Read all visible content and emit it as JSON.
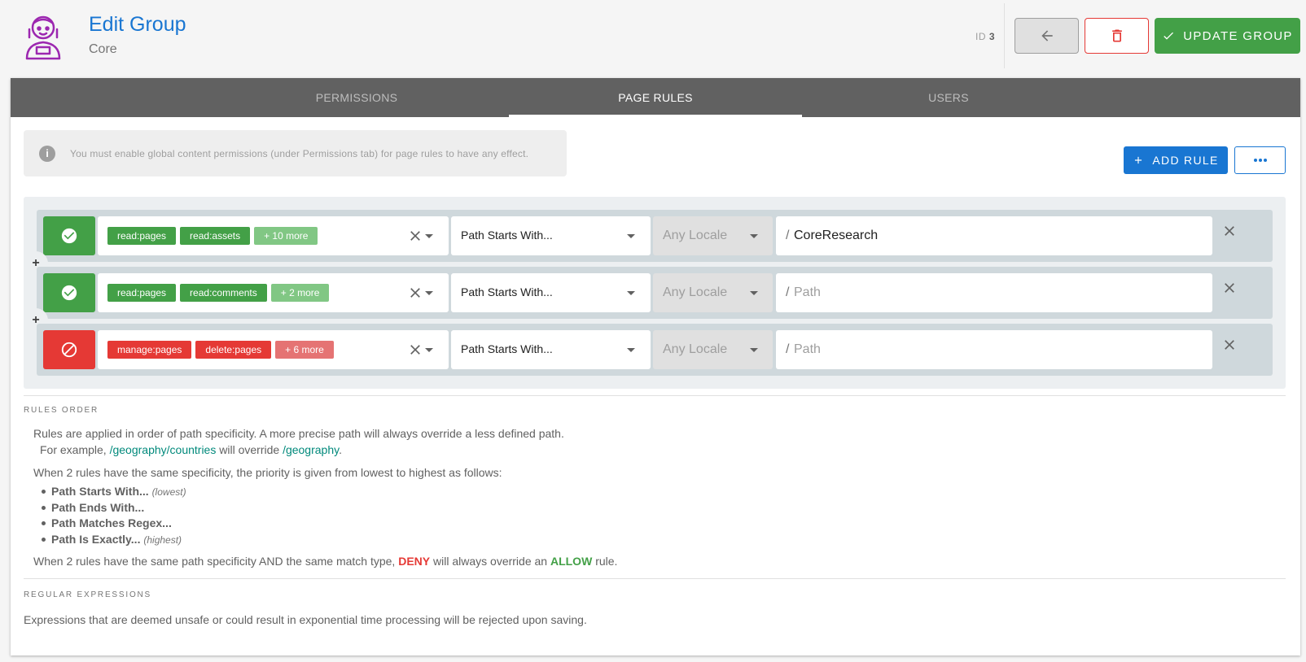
{
  "header": {
    "title": "Edit Group",
    "subtitle": "Core",
    "id_label": "ID",
    "id_value": "3",
    "update_label": "UPDATE GROUP"
  },
  "tabs": [
    {
      "label": "PERMISSIONS",
      "active": false
    },
    {
      "label": "PAGE RULES",
      "active": true
    },
    {
      "label": "USERS",
      "active": false
    }
  ],
  "info": {
    "message": "You must enable global content permissions (under Permissions tab) for page rules to have any effect."
  },
  "toolbar": {
    "add_rule_label": "ADD RULE"
  },
  "rules": [
    {
      "type": "allow",
      "chips": [
        "read:pages",
        "read:assets"
      ],
      "more": "+ 10 more",
      "match": "Path Starts With...",
      "locale_placeholder": "Any Locale",
      "path_prefix": "/",
      "path_value": "CoreResearch",
      "path_placeholder": "Path"
    },
    {
      "type": "allow",
      "chips": [
        "read:pages",
        "read:comments"
      ],
      "more": "+ 2 more",
      "match": "Path Starts With...",
      "locale_placeholder": "Any Locale",
      "path_prefix": "/",
      "path_value": "",
      "path_placeholder": "Path"
    },
    {
      "type": "deny",
      "chips": [
        "manage:pages",
        "delete:pages"
      ],
      "more": "+ 6 more",
      "match": "Path Starts With...",
      "locale_placeholder": "Any Locale",
      "path_prefix": "/",
      "path_value": "",
      "path_placeholder": "Path"
    }
  ],
  "rules_order": {
    "title": "RULES ORDER",
    "line1": "Rules are applied in order of path specificity. A more precise path will always override a less defined path.",
    "example_prefix": "For example,",
    "example_path1": "/geography/countries",
    "example_mid": "will override",
    "example_path2": "/geography",
    "example_suffix": ".",
    "line2": "When 2 rules have the same specificity, the priority is given from lowest to highest as follows:",
    "list": [
      {
        "label": "Path Starts With...",
        "note": "(lowest)"
      },
      {
        "label": "Path Ends With...",
        "note": ""
      },
      {
        "label": "Path Matches Regex...",
        "note": ""
      },
      {
        "label": "Path Is Exactly...",
        "note": "(highest)"
      }
    ],
    "line3_prefix": "When 2 rules have the same path specificity AND the same match type,",
    "deny_word": "DENY",
    "line3_mid": "will always override an",
    "allow_word": "ALLOW",
    "line3_suffix": "rule."
  },
  "regex": {
    "title": "REGULAR EXPRESSIONS",
    "text": "Expressions that are deemed unsafe or could result in exponential time processing will be rejected upon saving."
  },
  "colors": {
    "primary": "#1976d2",
    "allow": "#43a047",
    "deny": "#e53935",
    "tabs_bg": "#616161",
    "link": "#00897b"
  }
}
